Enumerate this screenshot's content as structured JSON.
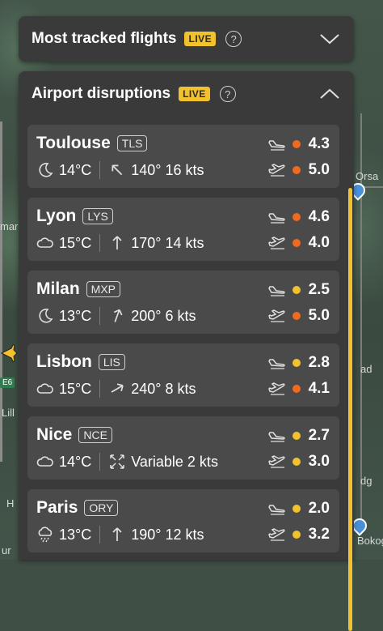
{
  "map": {
    "labels": [
      "Orsa",
      "mar",
      "Lill",
      "E6",
      "Bokoga",
      "ad",
      "dg",
      "H",
      "ur"
    ],
    "e6": "E6"
  },
  "panels": {
    "most_tracked": {
      "title": "Most tracked flights",
      "live": "LIVE",
      "help": "?"
    },
    "disruptions": {
      "title": "Airport disruptions",
      "live": "LIVE",
      "help": "?"
    }
  },
  "airports": [
    {
      "city": "Toulouse",
      "code": "TLS",
      "temp": "14°C",
      "wind": "140° 16 kts",
      "weather_icon": "moon-icon",
      "arr": "4.3",
      "arr_color": "#f06a1f",
      "dep": "5.0",
      "dep_color": "#f06a1f"
    },
    {
      "city": "Lyon",
      "code": "LYS",
      "temp": "15°C",
      "wind": "170° 14 kts",
      "weather_icon": "cloud-icon",
      "arr": "4.6",
      "arr_color": "#f06a1f",
      "dep": "4.0",
      "dep_color": "#f06a1f"
    },
    {
      "city": "Milan",
      "code": "MXP",
      "temp": "13°C",
      "wind": "200° 6 kts",
      "weather_icon": "moon-icon",
      "arr": "2.5",
      "arr_color": "#f2c12e",
      "dep": "5.0",
      "dep_color": "#f06a1f"
    },
    {
      "city": "Lisbon",
      "code": "LIS",
      "temp": "15°C",
      "wind": "240° 8 kts",
      "weather_icon": "cloud-icon",
      "arr": "2.8",
      "arr_color": "#f2c12e",
      "dep": "4.1",
      "dep_color": "#f06a1f"
    },
    {
      "city": "Nice",
      "code": "NCE",
      "temp": "14°C",
      "wind": "Variable 2 kts",
      "weather_icon": "cloud-icon",
      "arr": "2.7",
      "arr_color": "#f2c12e",
      "dep": "3.0",
      "dep_color": "#f2c12e"
    },
    {
      "city": "Paris",
      "code": "ORY",
      "temp": "13°C",
      "wind": "190° 12 kts",
      "weather_icon": "rain-cloud-icon",
      "arr": "2.0",
      "arr_color": "#f2c12e",
      "dep": "3.2",
      "dep_color": "#f2c12e"
    }
  ]
}
